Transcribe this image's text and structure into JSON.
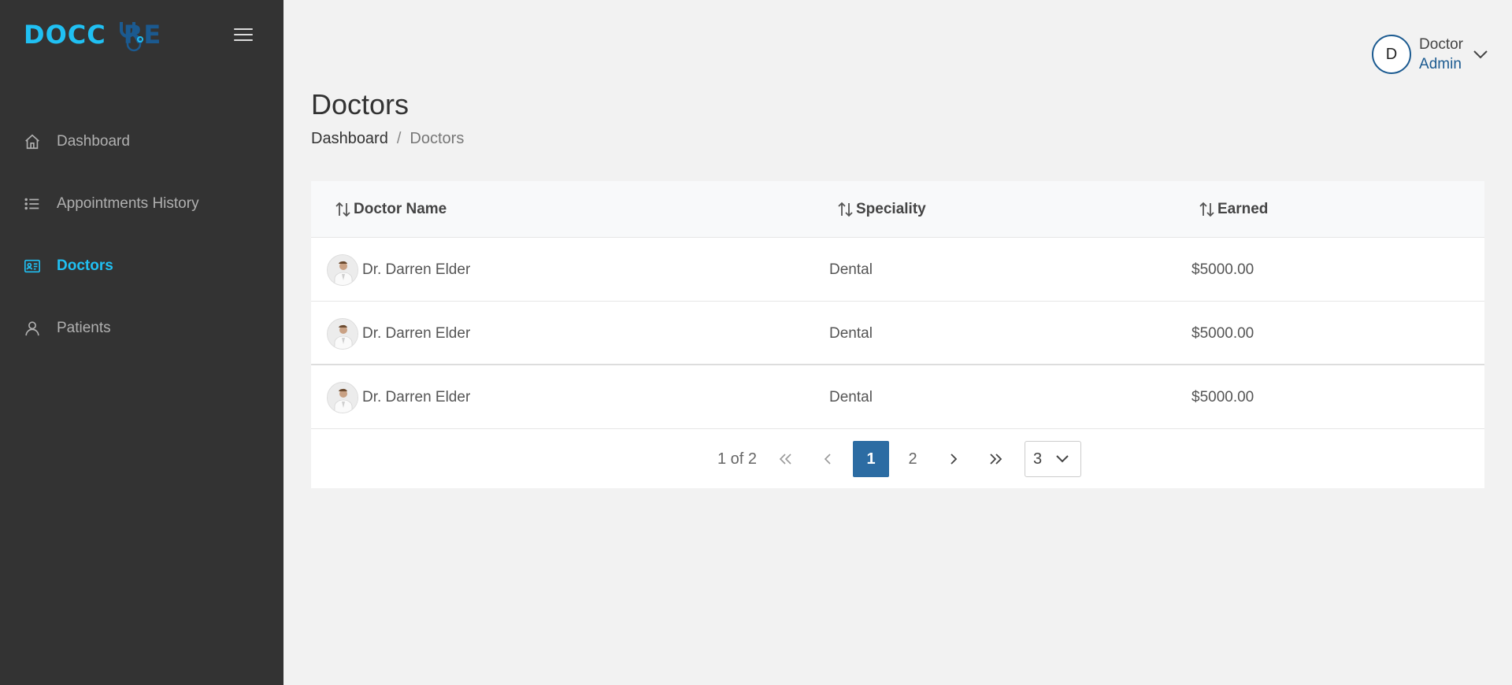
{
  "brand": {
    "logo_text_a": "DOCC",
    "logo_text_b": "RE"
  },
  "sidebar": {
    "items": [
      {
        "label": "Dashboard",
        "icon": "home-icon",
        "active": false
      },
      {
        "label": "Appointments History",
        "icon": "list-icon",
        "active": false
      },
      {
        "label": "Doctors",
        "icon": "id-card-icon",
        "active": true
      },
      {
        "label": "Patients",
        "icon": "user-icon",
        "active": false
      }
    ]
  },
  "header": {
    "user_initial": "D",
    "user_name": "Doctor",
    "user_role": "Admin"
  },
  "page": {
    "title": "Doctors",
    "breadcrumb": {
      "home": "Dashboard",
      "separator": "/",
      "current": "Doctors"
    }
  },
  "table": {
    "columns": [
      "Doctor Name",
      "Speciality",
      "Earned"
    ],
    "rows": [
      {
        "name": "Dr. Darren Elder",
        "speciality": "Dental",
        "earned": "$5000.00"
      },
      {
        "name": "Dr. Darren Elder",
        "speciality": "Dental",
        "earned": "$5000.00"
      },
      {
        "name": "Dr. Darren Elder",
        "speciality": "Dental",
        "earned": "$5000.00"
      }
    ]
  },
  "pagination": {
    "info": "1 of 2",
    "pages": [
      "1",
      "2"
    ],
    "current_page": "1",
    "page_size": "3"
  },
  "colors": {
    "accent": "#20c0f3",
    "brand_blue": "#1b5a90",
    "sidebar_bg": "#333333",
    "page_active": "#2c6ca3"
  }
}
